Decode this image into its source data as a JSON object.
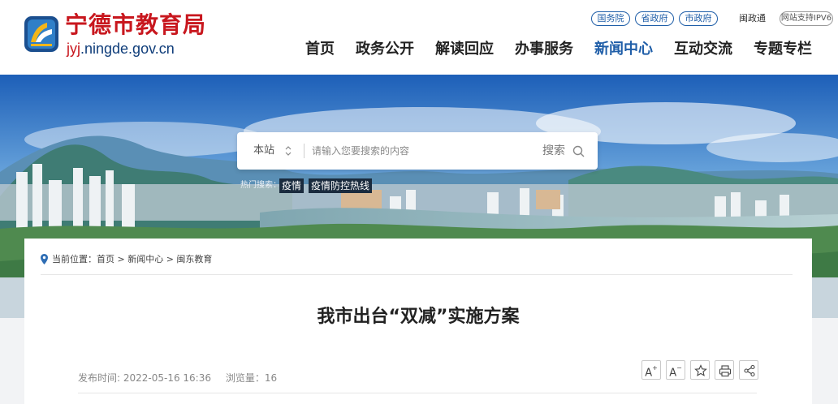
{
  "header": {
    "site_title": "宁德市教育局",
    "site_url_highlight": "jyj",
    "site_url_rest": ".ningde.gov.cn",
    "top_links": [
      "国务院",
      "省政府",
      "市政府"
    ],
    "min_zheng_tong": "闽政通",
    "ipv6_label": "网站支持IPV6",
    "nav": [
      {
        "label": "首页",
        "active": false
      },
      {
        "label": "政务公开",
        "active": false
      },
      {
        "label": "解读回应",
        "active": false
      },
      {
        "label": "办事服务",
        "active": false
      },
      {
        "label": "新闻中心",
        "active": true
      },
      {
        "label": "互动交流",
        "active": false
      },
      {
        "label": "专题专栏",
        "active": false
      }
    ],
    "accent_color": "#1f5ea8",
    "brand_red": "#c8171e"
  },
  "search": {
    "scope": "本站",
    "placeholder": "请输入您要搜索的内容",
    "button_label": "搜索",
    "hot_label": "热门搜索：",
    "hot_tags": [
      "疫情",
      "疫情防控热线"
    ]
  },
  "breadcrumb": {
    "text": "当前位置：首页 > 新闻中心 > 闽东教育"
  },
  "article": {
    "title": "我市出台“双减”实施方案",
    "publish_time": "发布时间: 2022-05-16 16:36",
    "views": "浏览量：16"
  },
  "tools": {
    "font_up": "A",
    "font_down": "A"
  }
}
